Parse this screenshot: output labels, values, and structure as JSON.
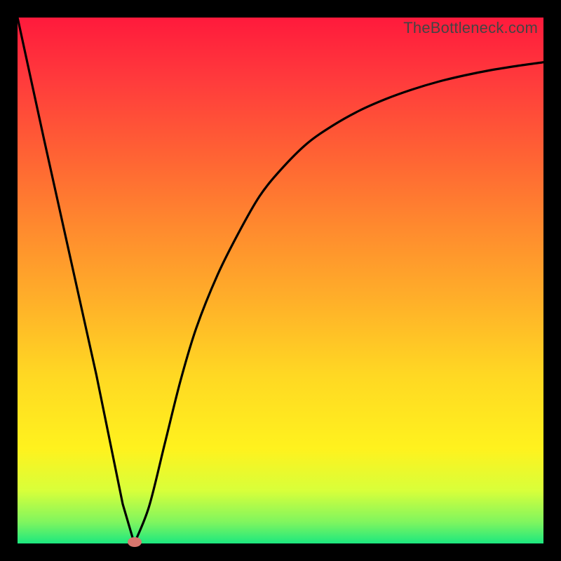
{
  "watermark": "TheBottleneck.com",
  "marker": {
    "x_frac": 0.222,
    "y_frac": 0.997
  },
  "chart_data": {
    "type": "line",
    "title": "",
    "xlabel": "",
    "ylabel": "",
    "xlim": [
      0,
      1
    ],
    "ylim": [
      0,
      1
    ],
    "series": [
      {
        "name": "bottleneck-curve",
        "x": [
          0.0,
          0.05,
          0.1,
          0.15,
          0.2,
          0.222,
          0.25,
          0.28,
          0.31,
          0.34,
          0.38,
          0.42,
          0.46,
          0.5,
          0.55,
          0.6,
          0.65,
          0.7,
          0.75,
          0.8,
          0.85,
          0.9,
          0.95,
          1.0
        ],
        "y": [
          1.0,
          0.77,
          0.545,
          0.32,
          0.075,
          0.0,
          0.07,
          0.19,
          0.31,
          0.41,
          0.51,
          0.59,
          0.66,
          0.71,
          0.76,
          0.795,
          0.823,
          0.845,
          0.863,
          0.878,
          0.89,
          0.9,
          0.908,
          0.915
        ]
      }
    ],
    "background_gradient": {
      "top": "#ff1a3c",
      "bottom": "#1ce87f"
    },
    "marker_color": "#d8766e"
  }
}
